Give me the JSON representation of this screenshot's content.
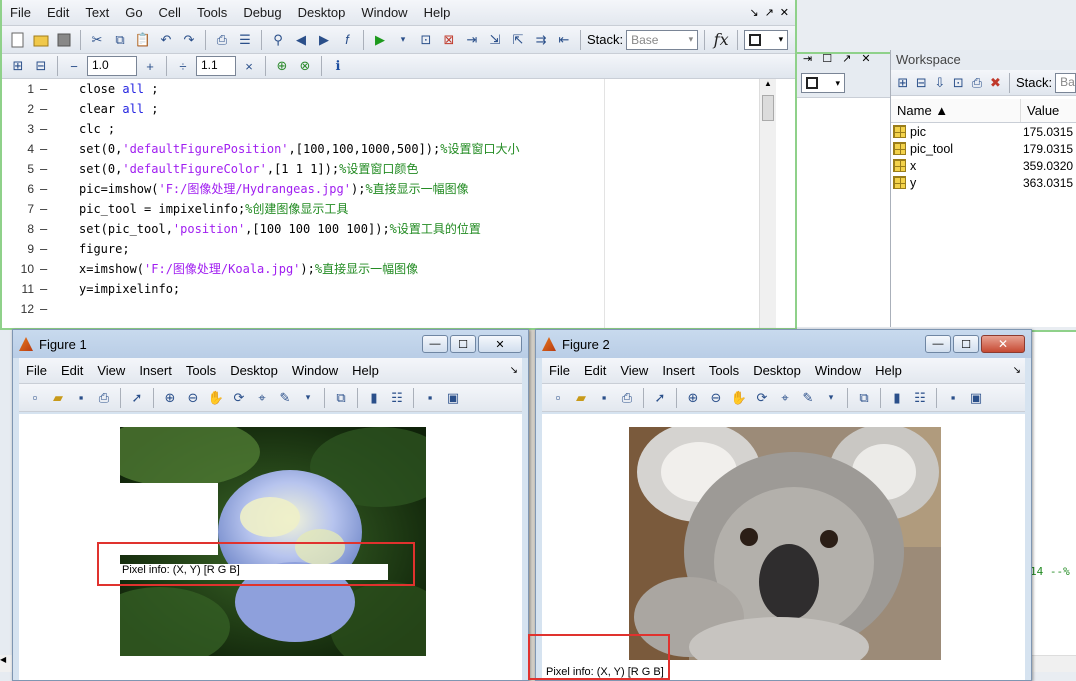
{
  "editor": {
    "menu": [
      "File",
      "Edit",
      "Text",
      "Go",
      "Cell",
      "Tools",
      "Debug",
      "Desktop",
      "Window",
      "Help"
    ],
    "stack_label": "Stack:",
    "stack_value": "Base",
    "fx_label": "fx",
    "cell_minus": "−",
    "cell_value1": "1.0",
    "cell_plus": "+",
    "cell_div": "÷",
    "cell_value2": "1.1",
    "cell_times": "×",
    "lines": [
      {
        "num": "1",
        "segments": [
          {
            "t": "close ",
            "c": ""
          },
          {
            "t": "all",
            "c": "kw"
          },
          {
            "t": " ;",
            "c": ""
          }
        ]
      },
      {
        "num": "2",
        "segments": [
          {
            "t": "clear ",
            "c": ""
          },
          {
            "t": "all",
            "c": "kw"
          },
          {
            "t": " ;",
            "c": ""
          }
        ]
      },
      {
        "num": "3",
        "segments": [
          {
            "t": "clc ;",
            "c": ""
          }
        ]
      },
      {
        "num": "4",
        "segments": [
          {
            "t": "set(0,",
            "c": ""
          },
          {
            "t": "'defaultFigurePosition'",
            "c": "str"
          },
          {
            "t": ",[100,100,1000,500]);",
            "c": ""
          },
          {
            "t": "%设置窗口大小",
            "c": "cmt"
          }
        ]
      },
      {
        "num": "5",
        "segments": [
          {
            "t": "set(0,",
            "c": ""
          },
          {
            "t": "'defaultFigureColor'",
            "c": "str"
          },
          {
            "t": ",[1 1 1]);",
            "c": ""
          },
          {
            "t": "%设置窗口颜色",
            "c": "cmt"
          }
        ]
      },
      {
        "num": "6",
        "segments": [
          {
            "t": "pic=imshow(",
            "c": ""
          },
          {
            "t": "'F:/图像处理/Hydrangeas.jpg'",
            "c": "str"
          },
          {
            "t": ");",
            "c": ""
          },
          {
            "t": "%直接显示一幅图像",
            "c": "cmt"
          }
        ]
      },
      {
        "num": "7",
        "segments": [
          {
            "t": "pic_tool = impixelinfo;",
            "c": ""
          },
          {
            "t": "%创建图像显示工具",
            "c": "cmt"
          }
        ]
      },
      {
        "num": "8",
        "segments": [
          {
            "t": "set(pic_tool,",
            "c": ""
          },
          {
            "t": "'position'",
            "c": "str"
          },
          {
            "t": ",[100 100 100 100]);",
            "c": ""
          },
          {
            "t": "%设置工具的位置",
            "c": "cmt"
          }
        ]
      },
      {
        "num": "9",
        "segments": [
          {
            "t": "figure;",
            "c": ""
          }
        ]
      },
      {
        "num": "10",
        "segments": [
          {
            "t": "x=imshow(",
            "c": ""
          },
          {
            "t": "'F:/图像处理/Koala.jpg'",
            "c": "str"
          },
          {
            "t": ");",
            "c": ""
          },
          {
            "t": "%直接显示一幅图像",
            "c": "cmt"
          }
        ]
      },
      {
        "num": "11",
        "segments": [
          {
            "t": "y=impixelinfo;",
            "c": ""
          }
        ]
      },
      {
        "num": "12",
        "segments": []
      }
    ]
  },
  "workspace": {
    "title": "Workspace",
    "stack_label": "Stack:",
    "stack_value": "Bas",
    "col_name": "Name ▲",
    "col_value": "Value",
    "vars": [
      {
        "name": "pic",
        "value": "175.0315"
      },
      {
        "name": "pic_tool",
        "value": "179.0315"
      },
      {
        "name": "x",
        "value": "359.0320"
      },
      {
        "name": "y",
        "value": "363.0315"
      }
    ],
    "partial_text": "14 --%"
  },
  "figure1": {
    "title": "Figure 1",
    "menu": [
      "File",
      "Edit",
      "View",
      "Insert",
      "Tools",
      "Desktop",
      "Window",
      "Help"
    ],
    "pixel_info": "Pixel info: (X, Y)  [R G B]"
  },
  "figure2": {
    "title": "Figure 2",
    "menu": [
      "File",
      "Edit",
      "View",
      "Insert",
      "Tools",
      "Desktop",
      "Window",
      "Help"
    ],
    "pixel_info": "Pixel info: (X, Y)  [R G B]"
  },
  "colors": {
    "accent": "#8fd18a",
    "highlight": "#e0322e"
  }
}
